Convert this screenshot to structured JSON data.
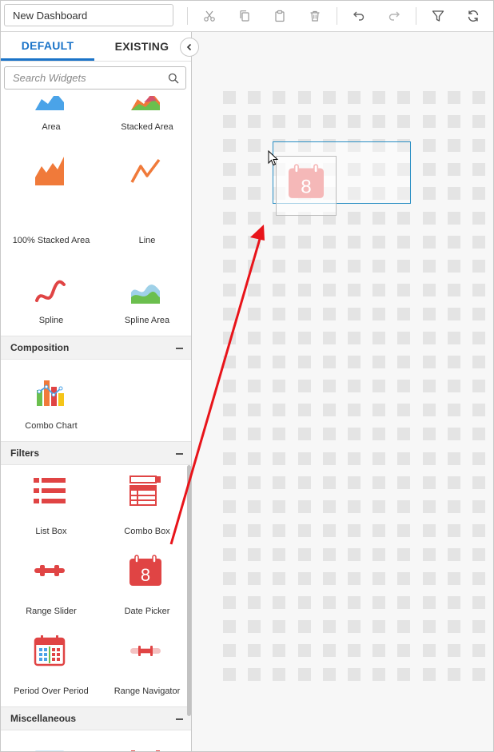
{
  "toolbar": {
    "title_value": "New Dashboard",
    "buttons": [
      {
        "name": "cut-button",
        "icon": "scissors-icon"
      },
      {
        "name": "copy-button",
        "icon": "copy-icon"
      },
      {
        "name": "paste-button",
        "icon": "clipboard-icon"
      },
      {
        "name": "delete-button",
        "icon": "trash-icon"
      },
      {
        "name": "undo-button",
        "icon": "undo-icon"
      },
      {
        "name": "redo-button",
        "icon": "redo-icon"
      },
      {
        "name": "filter-button",
        "icon": "filter-icon"
      },
      {
        "name": "refresh-button",
        "icon": "refresh-icon"
      }
    ]
  },
  "tabs": {
    "default_label": "DEFAULT",
    "existing_label": "EXISTING"
  },
  "search": {
    "placeholder": "Search Widgets"
  },
  "widgets": {
    "area": "Area",
    "stacked_area": "Stacked Area",
    "stacked_area_100": "100% Stacked Area",
    "line": "Line",
    "spline": "Spline",
    "spline_area": "Spline Area",
    "combo_chart": "Combo Chart",
    "list_box": "List Box",
    "combo_box": "Combo Box",
    "range_slider": "Range Slider",
    "date_picker": "Date Picker",
    "period_over_period": "Period Over Period",
    "range_navigator": "Range Navigator"
  },
  "groups": {
    "composition": "Composition",
    "filters": "Filters",
    "miscellaneous": "Miscellaneous"
  },
  "drag": {
    "ghost_icon_text": "8",
    "date_picker_icon_text": "8"
  },
  "colors": {
    "accent": "#1a73c8",
    "widget_red": "#e04444",
    "annotation_arrow": "#e8141a",
    "drop_zone_border": "#2a8fc4"
  }
}
